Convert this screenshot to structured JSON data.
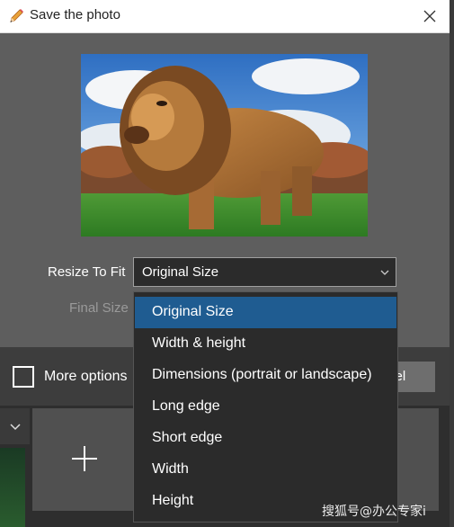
{
  "dialog": {
    "title": "Save the photo",
    "title_icon": "pencil-icon",
    "close_icon": "close-icon"
  },
  "preview": {
    "image": "lion-photo"
  },
  "form": {
    "resize_label": "Resize To Fit",
    "resize_selected": "Original Size",
    "final_size_label": "Final Size"
  },
  "dropdown": {
    "options": [
      "Original Size",
      "Width & height",
      "Dimensions (portrait or landscape)",
      "Long edge",
      "Short edge",
      "Width",
      "Height"
    ],
    "selected_index": 0
  },
  "footer": {
    "more_options_label": "More options",
    "more_options_checked": false,
    "cancel_label": "Cancel",
    "cancel_label_visible": "cel"
  },
  "background": {
    "add_icon": "plus-icon",
    "chevron_icon": "chevron-down-icon"
  },
  "watermark": {
    "text": "搜狐号@办公专家i"
  },
  "colors": {
    "selected_item": "#1f5c91",
    "dropdown_bg": "#2b2b2b",
    "dialog_bg": "#5e5e5e"
  }
}
